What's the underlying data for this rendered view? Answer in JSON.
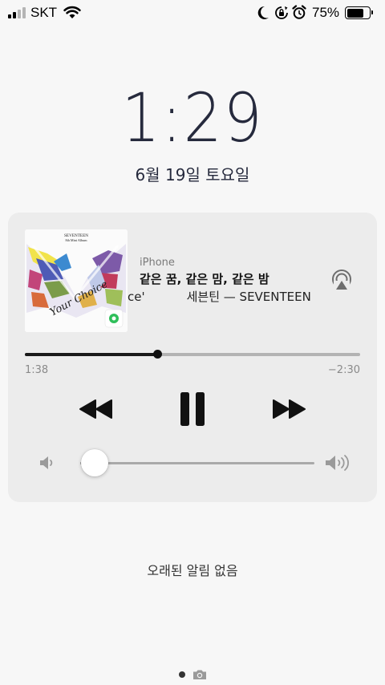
{
  "status_bar": {
    "carrier": "SKT",
    "signal_bars_active": 2,
    "signal_bars_total": 4,
    "battery_percent": "75%",
    "battery_level": 0.75,
    "icons": [
      "moon-icon",
      "orientation-lock-icon",
      "alarm-icon"
    ]
  },
  "lock_screen": {
    "time": "1:29",
    "date": "6월 19일 토요일"
  },
  "now_playing": {
    "device": "iPhone",
    "track_title": "같은 꿈, 같은 맘, 같은 밤",
    "artist_line_clipped_left": "ce'",
    "artist_line": "세븐틴 — SEVENTEEN",
    "album_art_text": [
      "SEVENTEEN",
      "8th Mini Album"
    ],
    "album_art_script": "Your Choice",
    "elapsed": "1:38",
    "remaining": "−2:30",
    "progress": 0.395,
    "volume": 0.06,
    "controls": {
      "previous": "rewind-icon",
      "play_pause": "pause-icon",
      "next": "fast-forward-icon",
      "airplay": "airplay-icon"
    }
  },
  "notifications": {
    "empty_label": "오래된 알림 없음"
  },
  "colors": {
    "background": "#f7f7f7",
    "player_background": "#ececec",
    "clock_text": "#262a3d",
    "track_inactive": "#b3b3b3"
  }
}
